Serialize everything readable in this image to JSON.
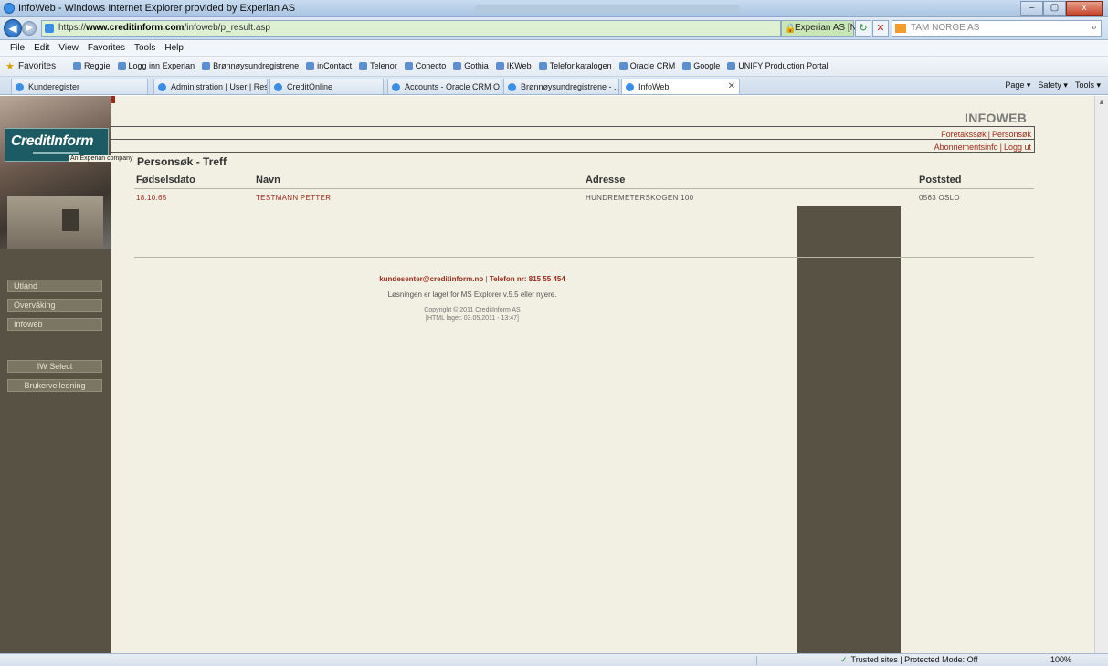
{
  "window": {
    "title": "InfoWeb - Windows Internet Explorer provided by Experian AS",
    "controls": [
      "–",
      "▢",
      "x"
    ]
  },
  "address": {
    "url_prefix": "https://",
    "url_domain": "www.creditinform.com",
    "url_path": "/infoweb/p_result.asp",
    "cert_label": "Experian AS [NO]",
    "search_placeholder": "TAM NORGE AS"
  },
  "menu": [
    "File",
    "Edit",
    "View",
    "Favorites",
    "Tools",
    "Help"
  ],
  "favorites": {
    "label": "Favorites",
    "items": [
      "Reggie",
      "Logg inn Experian",
      "Brønnøysundregistrene",
      "inContact",
      "Telenor",
      "Conecto",
      "Gothia",
      "IKWeb",
      "Telefonkatalogen",
      "Oracle CRM",
      "Google",
      "UNIFY Production Portal"
    ]
  },
  "tabs": [
    {
      "label": "Kunderegister"
    },
    {
      "label": "Administration | User | Res..."
    },
    {
      "label": "CreditOnline"
    },
    {
      "label": "Accounts - Oracle CRM O..."
    },
    {
      "label": "Brønnøysundregistrene - ..."
    },
    {
      "label": "InfoWeb"
    }
  ],
  "command_bar": [
    "Page ▾",
    "Safety ▾",
    "Tools ▾"
  ],
  "page": {
    "app_title": "INFOWEB",
    "logo_text": "CreditInform",
    "company_tag": "An Experian company",
    "top_links_1": [
      "Foretakssøk",
      "Personsøk"
    ],
    "top_links_2": [
      "Abonnementsinfo",
      "Logg ut"
    ],
    "sidebar": [
      "Utland",
      "Overvåking",
      "Infoweb",
      "IW Select",
      "Brukerveiledning"
    ],
    "heading": "Personsøk - Treff",
    "columns": [
      "Fødselsdato",
      "Navn",
      "Adresse",
      "Poststed"
    ],
    "rows": [
      {
        "dob": "18.10.65",
        "name": "TESTMANN PETTER",
        "address": "HUNDREMETERSKOGEN 100",
        "postal": "0563 OSLO"
      }
    ],
    "footer": {
      "email": "kundesenter@creditinform.no",
      "phone": "Telefon nr: 815 55 454",
      "note": "Løsningen er laget for MS Explorer v.5.5 eller nyere.",
      "copyright": "Copyright © 2011 CreditInform AS",
      "built": "[HTML laget: 03.05.2011 - 13:47]"
    }
  },
  "status": {
    "zone": "Trusted sites | Protected Mode: Off",
    "zoom": "100%"
  }
}
